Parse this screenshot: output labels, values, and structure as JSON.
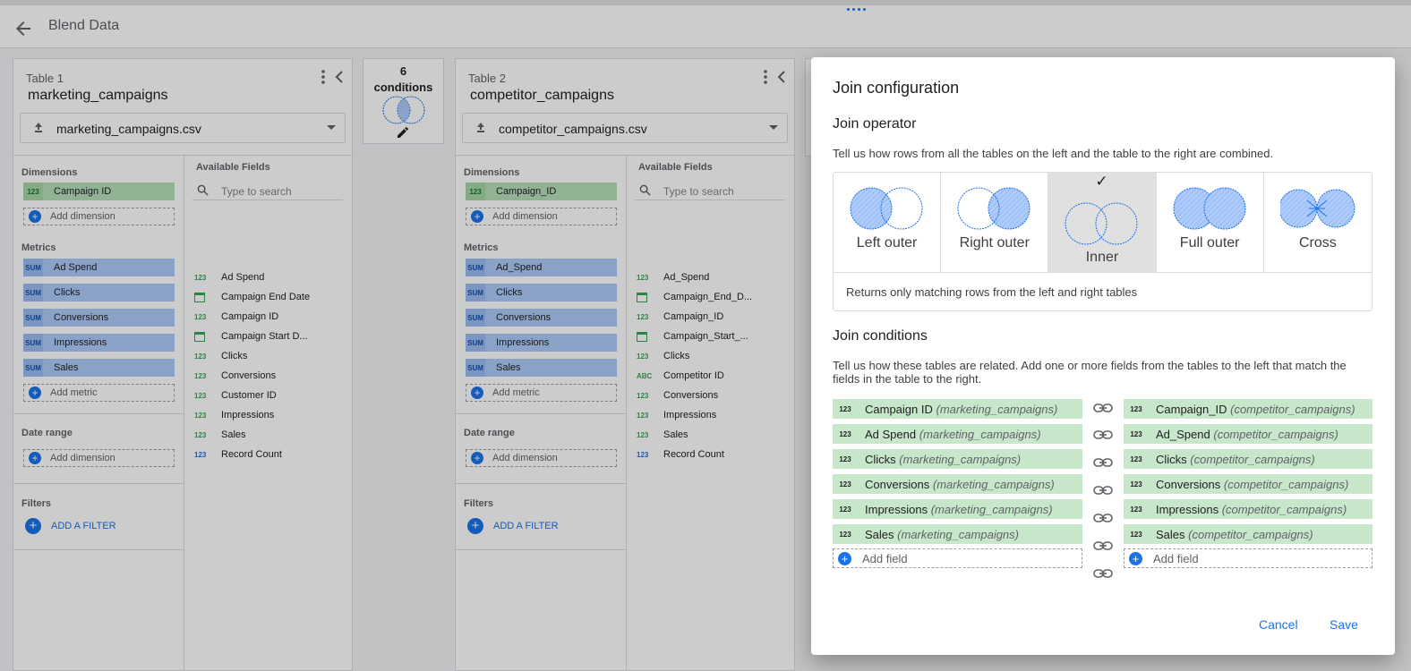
{
  "header": {
    "title": "Blend Data"
  },
  "table1": {
    "label": "Table 1",
    "name": "marketing_campaigns",
    "source": "marketing_campaigns.csv",
    "dimensions_label": "Dimensions",
    "dimension": "Campaign ID",
    "add_dimension": "Add dimension",
    "metrics_label": "Metrics",
    "metrics": [
      "Ad Spend",
      "Clicks",
      "Conversions",
      "Impressions",
      "Sales"
    ],
    "add_metric": "Add metric",
    "date_range_label": "Date range",
    "date_add_dimension": "Add dimension",
    "filters_label": "Filters",
    "add_filter": "ADD A FILTER",
    "available_label": "Available Fields",
    "search_placeholder": "Type to search",
    "fields": [
      "Ad Spend",
      "Campaign End Date",
      "Campaign ID",
      "Campaign Start D...",
      "Clicks",
      "Conversions",
      "Customer ID",
      "Impressions",
      "Sales",
      "Record Count"
    ]
  },
  "table2": {
    "label": "Table 2",
    "name": "competitor_campaigns",
    "source": "competitor_campaigns.csv",
    "dimensions_label": "Dimensions",
    "dimension": "Campaign_ID",
    "add_dimension": "Add dimension",
    "metrics_label": "Metrics",
    "metrics": [
      "Ad_Spend",
      "Clicks",
      "Conversions",
      "Impressions",
      "Sales"
    ],
    "add_metric": "Add metric",
    "date_range_label": "Date range",
    "date_add_dimension": "Add dimension",
    "filters_label": "Filters",
    "add_filter": "ADD A FILTER",
    "available_label": "Available Fields",
    "search_placeholder": "Type to search",
    "fields": [
      "Ad_Spend",
      "Campaign_End_D...",
      "Campaign_ID",
      "Campaign_Start_...",
      "Clicks",
      "Competitor ID",
      "Conversions",
      "Impressions",
      "Sales",
      "Record Count"
    ]
  },
  "conditions": {
    "count": "6",
    "label": "conditions"
  },
  "dialog": {
    "title": "Join configuration",
    "operator_heading": "Join operator",
    "operator_desc": "Tell us how rows from all the tables on the left and the table to the right are combined.",
    "operators": [
      "Left outer",
      "Right outer",
      "Inner",
      "Full outer",
      "Cross"
    ],
    "check": "✓",
    "operator_note": "Returns only matching rows from the left and right tables",
    "conditions_heading": "Join conditions",
    "conditions_desc": "Tell us how these tables are related. Add one or more fields from the tables to the left that match the fields in the table to the right.",
    "left_fields": [
      "Campaign ID",
      "Ad Spend",
      "Clicks",
      "Conversions",
      "Impressions",
      "Sales"
    ],
    "left_source": "(marketing_campaigns)",
    "right_fields": [
      "Campaign_ID",
      "Ad_Spend",
      "Clicks",
      "Conversions",
      "Impressions",
      "Sales"
    ],
    "right_source": "(competitor_campaigns)",
    "add_field": "Add field",
    "cancel": "Cancel",
    "save": "Save"
  },
  "badges": {
    "num": "123",
    "sum": "SUM",
    "abc": "ABC"
  }
}
